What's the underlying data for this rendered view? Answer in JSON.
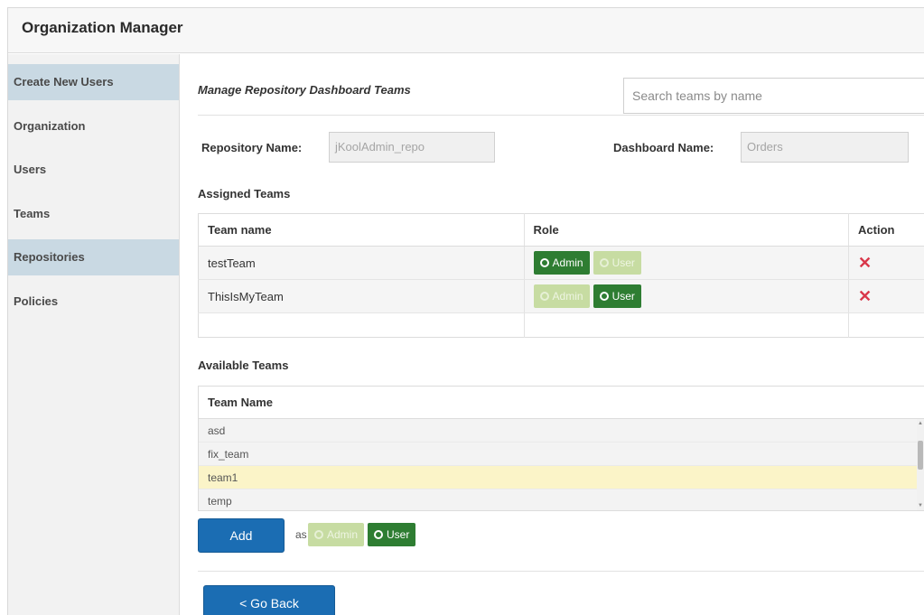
{
  "app": {
    "title": "Organization Manager"
  },
  "sidebar": {
    "items": [
      {
        "label": "Create New Users",
        "active": true
      },
      {
        "label": "Organization",
        "active": false
      },
      {
        "label": "Users",
        "active": false
      },
      {
        "label": "Teams",
        "active": false
      },
      {
        "label": "Repositories",
        "active": true
      },
      {
        "label": "Policies",
        "active": false
      }
    ]
  },
  "main": {
    "heading": "Manage Repository Dashboard Teams",
    "search": {
      "placeholder": "Search teams by name",
      "value": ""
    },
    "repository": {
      "label": "Repository Name:",
      "value": "jKoolAdmin_repo"
    },
    "dashboard": {
      "label": "Dashboard Name:",
      "value": "Orders"
    },
    "assigned": {
      "title": "Assigned Teams",
      "headers": [
        "Team name",
        "Role",
        "Action"
      ],
      "rows": [
        {
          "team": "testTeam",
          "role": "Admin"
        },
        {
          "team": "ThisIsMyTeam",
          "role": "User"
        }
      ],
      "role_labels": {
        "admin": "Admin",
        "user": "User"
      }
    },
    "available": {
      "title": "Available Teams",
      "header": "Team Name",
      "rows": [
        "asd",
        "fix_team",
        "team1",
        "temp"
      ],
      "selected": "team1"
    },
    "add": {
      "button": "Add",
      "as": "as",
      "role_selected": "User"
    },
    "go_back": "< Go Back"
  },
  "colors": {
    "active_green": "#2e7d32",
    "inactive_green": "#c7dca2",
    "primary_blue": "#1b6db3",
    "delete_red": "#d9374a",
    "selected_row": "#fbf4c8",
    "sidebar_active": "#c9d9e3"
  },
  "icons": {
    "remove": "x-icon",
    "radio": "radio-dot-icon"
  }
}
